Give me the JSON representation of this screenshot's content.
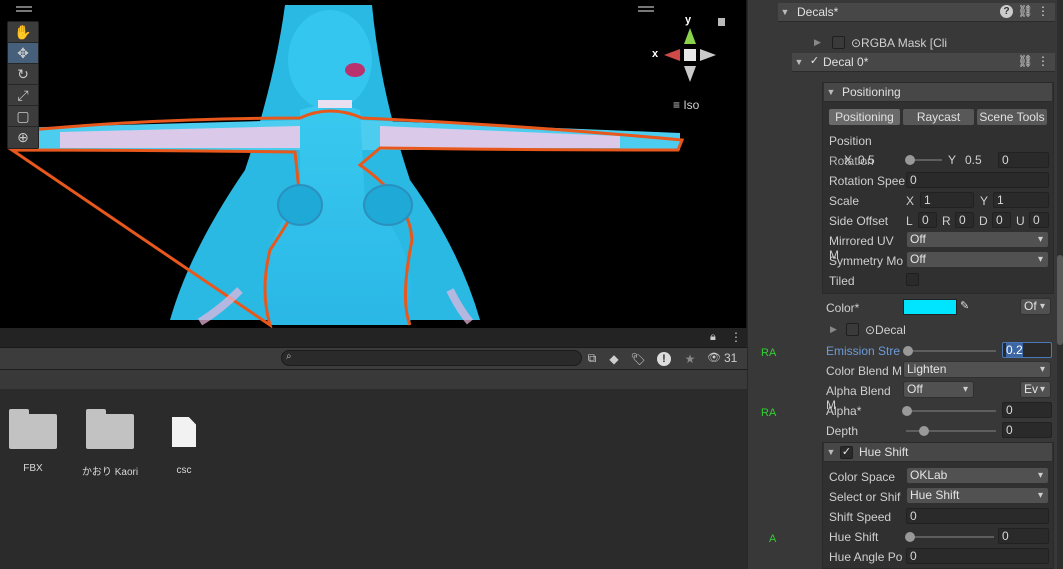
{
  "scene": {
    "gizmo": {
      "y_label": "y",
      "x_label": "x",
      "projection": "Iso"
    }
  },
  "project": {
    "hidden_count": "31",
    "assets": [
      {
        "name": "FBX",
        "kind": "folder"
      },
      {
        "name": "かおり Kaori",
        "kind": "folder"
      },
      {
        "name": "csc",
        "kind": "file"
      }
    ]
  },
  "inspector": {
    "gutter_tags": [
      "RA",
      "RA",
      "A"
    ],
    "decals_header": "Decals*",
    "rgba_mask": "⊙RGBA Mask [Cli",
    "decal0_header": "Decal 0*",
    "positioning_header": "Positioning",
    "tabs": [
      "Positioning",
      "Raycast",
      "Scene Tools"
    ],
    "position_label": "Position",
    "position_x_label": "X",
    "position_x": "0.5",
    "position_y_label": "Y",
    "position_y": "0.5",
    "rotation_label": "Rotation",
    "rotation_value": "0",
    "rotation_speed_label": "Rotation Spee",
    "rotation_speed": "0",
    "scale_label": "Scale",
    "scale_x": "1",
    "scale_y": "1",
    "side_offset_label": "Side Offset",
    "side_offsets": [
      {
        "k": "L",
        "v": "0"
      },
      {
        "k": "R",
        "v": "0"
      },
      {
        "k": "D",
        "v": "0"
      },
      {
        "k": "U",
        "v": "0"
      }
    ],
    "mirrored_label": "Mirrored UV M",
    "mirrored_value": "Off",
    "symmetry_label": "Symmetry Mo",
    "symmetry_value": "Off",
    "tiled_label": "Tiled",
    "color_label": "Color*",
    "color_hex": "#00e5ff",
    "color_option": "Of",
    "decal_ref": "⊙Decal",
    "emission_label": "Emission Stre",
    "emission_value": "0.2",
    "color_blend_label": "Color Blend M",
    "color_blend_value": "Lighten",
    "alpha_blend_label": "Alpha Blend M",
    "alpha_blend_value": "Off",
    "alpha_blend_extra": "Ev",
    "alpha_label": "Alpha*",
    "alpha_value": "0",
    "depth_label": "Depth",
    "depth_value": "0",
    "hue_shift_header": "Hue Shift",
    "color_space_label": "Color Space",
    "color_space_value": "OKLab",
    "select_shift_label": "Select or Shif",
    "select_shift_value": "Hue Shift",
    "shift_speed_label": "Shift Speed",
    "shift_speed_value": "0",
    "hue_shift_label": "Hue Shift",
    "hue_shift_value": "0",
    "hue_angle_label": "Hue Angle Po",
    "hue_angle_value": "0"
  },
  "colors": {
    "accent_blue": "#6d9bd8",
    "outline_orange": "#e8581c",
    "character_cyan": "#3fd8ff"
  }
}
